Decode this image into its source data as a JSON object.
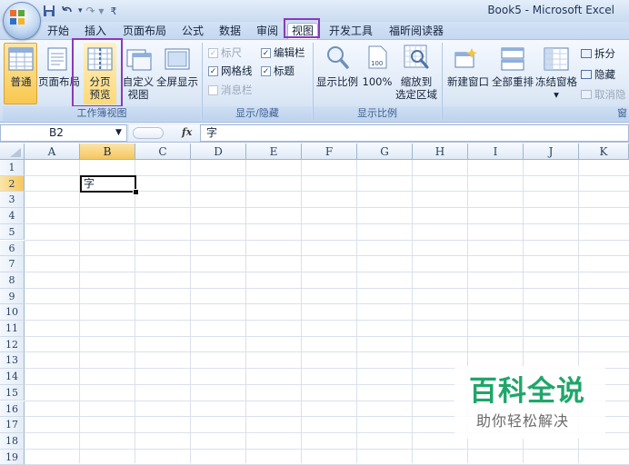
{
  "window": {
    "title": "Book5 - Microsoft Excel",
    "qat_redo": "↷ ▾"
  },
  "tabs": [
    {
      "label": "开始",
      "active": false
    },
    {
      "label": "插入",
      "active": false
    },
    {
      "label": "页面布局",
      "active": false
    },
    {
      "label": "公式",
      "active": false
    },
    {
      "label": "数据",
      "active": false
    },
    {
      "label": "审阅",
      "active": false
    },
    {
      "label": "视图",
      "active": true
    },
    {
      "label": "开发工具",
      "active": false
    },
    {
      "label": "福昕阅读器",
      "active": false
    }
  ],
  "ribbon": {
    "workbook_views": {
      "group_label": "工作簿视图",
      "normal": "普通",
      "page_layout": "页面布局",
      "page_break_line1": "分页",
      "page_break_line2": "预览",
      "custom_line1": "自定义",
      "custom_line2": "视图",
      "full_screen": "全屏显示"
    },
    "show_hide": {
      "group_label": "显示/隐藏",
      "ruler": {
        "label": "标尺",
        "checked": true,
        "enabled": false
      },
      "formula_bar": {
        "label": "编辑栏",
        "checked": true,
        "enabled": true
      },
      "gridlines": {
        "label": "网格线",
        "checked": true,
        "enabled": true
      },
      "headings": {
        "label": "标题",
        "checked": true,
        "enabled": true
      },
      "message_bar": {
        "label": "消息栏",
        "checked": false,
        "enabled": false
      },
      "check_mark": "✓"
    },
    "zoom": {
      "group_label": "显示比例",
      "zoom": "显示比例",
      "hundred": "100%",
      "to_selection_line1": "缩放到",
      "to_selection_line2": "选定区域"
    },
    "window": {
      "group_label": "窗",
      "new_window": "新建窗口",
      "arrange_all": "全部重排",
      "freeze_panes": "冻结窗格",
      "freeze_arrow": "▾",
      "split": "拆分",
      "hide": "隐藏",
      "unhide": "取消隐"
    }
  },
  "formula_bar": {
    "name_box": "B2",
    "name_box_arrow": "▼",
    "fx": "fx",
    "content": "字"
  },
  "sheet": {
    "columns": [
      "A",
      "B",
      "C",
      "D",
      "E",
      "F",
      "G",
      "H",
      "I",
      "J",
      "K"
    ],
    "rows": [
      "1",
      "2",
      "3",
      "4",
      "5",
      "6",
      "7",
      "8",
      "9",
      "10",
      "11",
      "12",
      "13",
      "14",
      "15",
      "16",
      "17",
      "18",
      "19"
    ],
    "selected_cell": "B2",
    "cell_b2": "字"
  },
  "watermark": {
    "title": "百科全说",
    "subtitle": "助你轻松解决"
  },
  "colors": {
    "highlight_box": "#8a3ab9",
    "watermark_green": "#1fa66a",
    "selected_header": "#f6c65e"
  }
}
